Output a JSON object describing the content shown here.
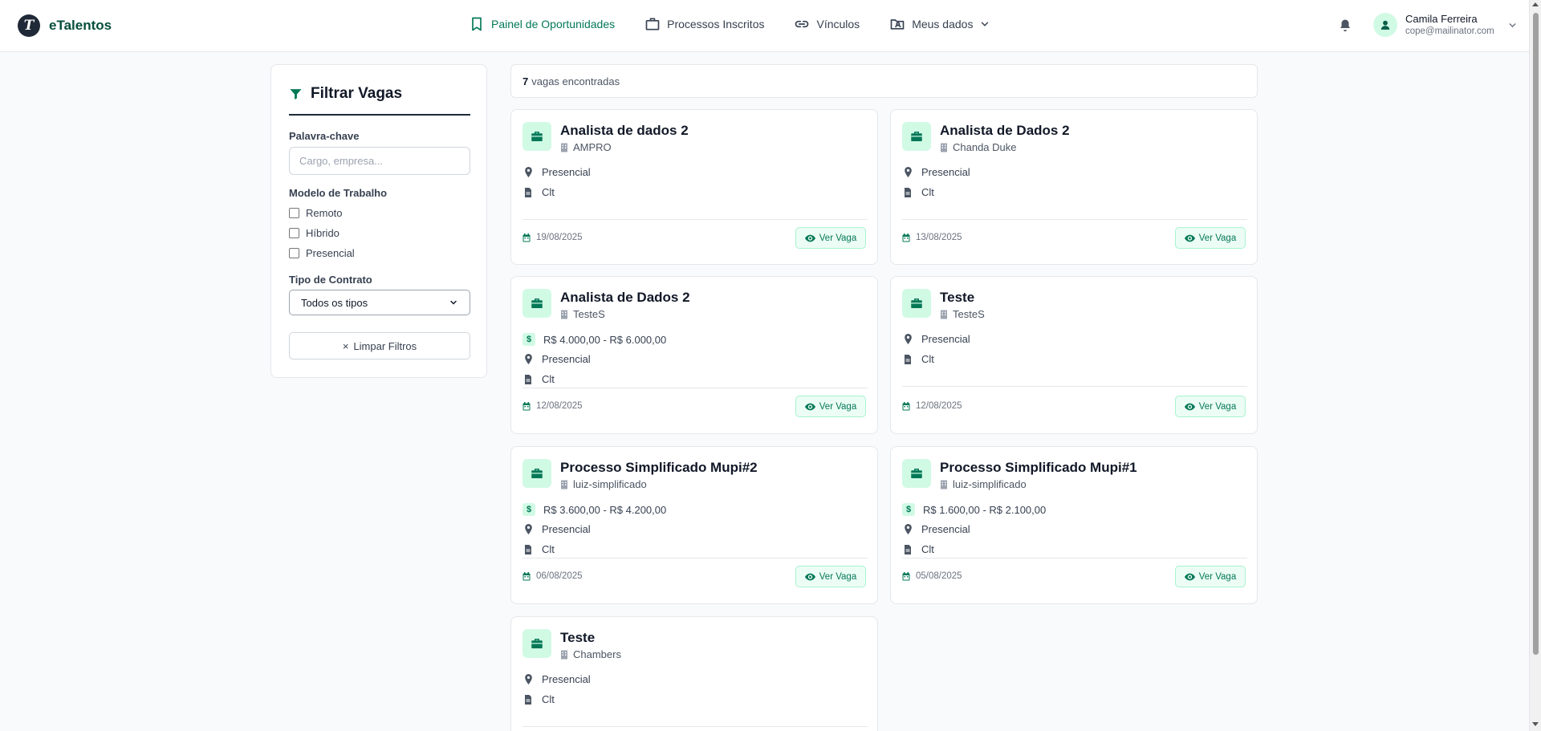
{
  "app": {
    "name": "eTalentos",
    "logo_letter": "T"
  },
  "nav": {
    "items": [
      {
        "label": "Painel de Oportunidades",
        "icon": "bookmark-icon",
        "active": true
      },
      {
        "label": "Processos Inscritos",
        "icon": "briefcase-icon",
        "active": false
      },
      {
        "label": "Vínculos",
        "icon": "link-icon",
        "active": false
      },
      {
        "label": "Meus dados",
        "icon": "folder-user-icon",
        "active": false
      }
    ]
  },
  "user": {
    "name": "Camila Ferreira",
    "email": "cope@mailinator.com"
  },
  "filter": {
    "title": "Filtrar Vagas",
    "keyword_label": "Palavra-chave",
    "keyword_placeholder": "Cargo, empresa...",
    "keyword_value": "",
    "work_model_label": "Modelo de Trabalho",
    "work_models": [
      "Remoto",
      "Híbrido",
      "Presencial"
    ],
    "contract_label": "Tipo de Contrato",
    "contract_selected": "Todos os tipos",
    "clear_label": "Limpar Filtros",
    "clear_icon": "×"
  },
  "results": {
    "count": "7",
    "text": "vagas encontradas"
  },
  "view_label": "Ver Vaga",
  "jobs": [
    {
      "title": "Analista de dados 2",
      "company": "AMPRO",
      "salary": "",
      "modality": "Presencial",
      "contract": "Clt",
      "date": "19/08/2025"
    },
    {
      "title": "Analista de Dados 2",
      "company": "Chanda Duke",
      "salary": "",
      "modality": "Presencial",
      "contract": "Clt",
      "date": "13/08/2025"
    },
    {
      "title": "Analista de Dados 2",
      "company": "TesteS",
      "salary": "R$ 4.000,00 - R$ 6.000,00",
      "modality": "Presencial",
      "contract": "Clt",
      "date": "12/08/2025"
    },
    {
      "title": "Teste",
      "company": "TesteS",
      "salary": "",
      "modality": "Presencial",
      "contract": "Clt",
      "date": "12/08/2025"
    },
    {
      "title": "Processo Simplificado Mupi#2",
      "company": "luiz-simplificado",
      "salary": "R$ 3.600,00 - R$ 4.200,00",
      "modality": "Presencial",
      "contract": "Clt",
      "date": "06/08/2025"
    },
    {
      "title": "Processo Simplificado Mupi#1",
      "company": "luiz-simplificado",
      "salary": "R$ 1.600,00 - R$ 2.100,00",
      "modality": "Presencial",
      "contract": "Clt",
      "date": "05/08/2025"
    },
    {
      "title": "Teste",
      "company": "Chambers",
      "salary": "",
      "modality": "Presencial",
      "contract": "Clt",
      "date": ""
    }
  ],
  "colors": {
    "accent": "#047857",
    "accent_light": "#d1fae5",
    "brand_text": "#064e3b"
  }
}
